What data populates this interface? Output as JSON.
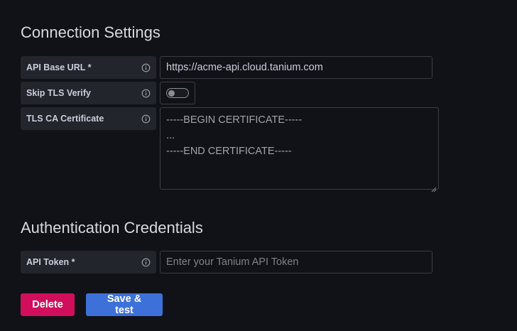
{
  "connection": {
    "title": "Connection Settings",
    "api_base_url": {
      "label": "API Base URL *",
      "value": "https://acme-api.cloud.tanium.com"
    },
    "skip_tls": {
      "label": "Skip TLS Verify",
      "enabled": false
    },
    "tls_ca": {
      "label": "TLS CA Certificate",
      "lines": [
        "-----BEGIN CERTIFICATE-----",
        "...",
        "-----END CERTIFICATE-----"
      ]
    }
  },
  "auth": {
    "title": "Authentication Credentials",
    "api_token": {
      "label": "API Token *",
      "placeholder": "Enter your Tanium API Token"
    }
  },
  "actions": {
    "delete_label": "Delete",
    "save_label": "Save & test"
  },
  "icons": {
    "field_info": "info-circle-icon",
    "textarea_resize": "resize-grip-icon"
  },
  "colors": {
    "background": "#111217",
    "label_bg": "#22252b",
    "delete": "#d10e5c",
    "primary": "#3d71d9"
  }
}
